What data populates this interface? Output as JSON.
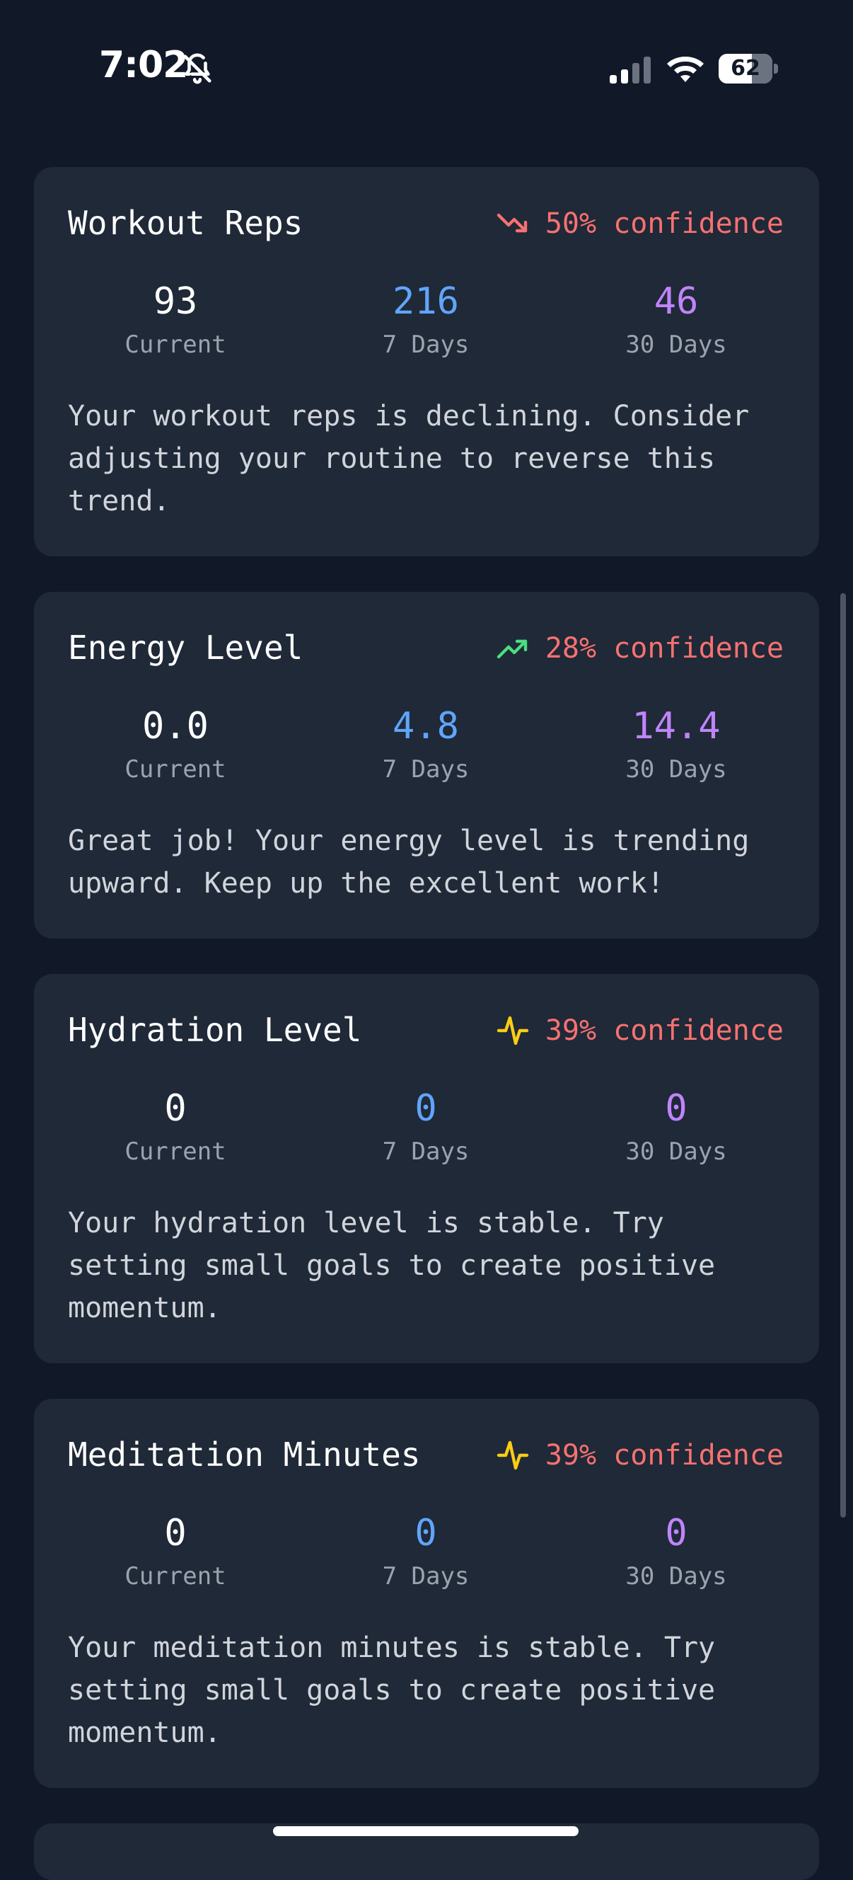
{
  "status_bar": {
    "time": "7:02",
    "battery_level": "62",
    "icons": [
      "bell-slash-icon",
      "cellular-signal-icon",
      "wifi-icon",
      "battery-icon"
    ]
  },
  "colors": {
    "background": "#111827",
    "card": "#1f2937",
    "confidence": "#f87171",
    "current": "#ffffff",
    "seven_day": "#60a5fa",
    "thirty_day": "#c084fc",
    "trend_down": "#f87171",
    "trend_up": "#4ade80",
    "stable": "#facc15"
  },
  "cards": [
    {
      "title": "Workout Reps",
      "trend_icon": "trending-down-icon",
      "confidence": "50% confidence",
      "current": {
        "value": "93",
        "label": "Current"
      },
      "seven_days": {
        "value": "216",
        "label": "7 Days"
      },
      "thirty_days": {
        "value": "46",
        "label": "30 Days"
      },
      "message": "Your workout reps is declining. Consider adjusting your routine to reverse this trend."
    },
    {
      "title": "Energy Level",
      "trend_icon": "trending-up-icon",
      "confidence": "28% confidence",
      "current": {
        "value": "0.0",
        "label": "Current"
      },
      "seven_days": {
        "value": "4.8",
        "label": "7 Days"
      },
      "thirty_days": {
        "value": "14.4",
        "label": "30 Days"
      },
      "message": "Great job! Your energy level is trending upward. Keep up the excellent work!"
    },
    {
      "title": "Hydration Level",
      "trend_icon": "activity-pulse-icon",
      "confidence": "39% confidence",
      "current": {
        "value": "0",
        "label": "Current"
      },
      "seven_days": {
        "value": "0",
        "label": "7 Days"
      },
      "thirty_days": {
        "value": "0",
        "label": "30 Days"
      },
      "message": "Your hydration level is stable. Try setting small goals to create positive momentum."
    },
    {
      "title": "Meditation Minutes",
      "trend_icon": "activity-pulse-icon",
      "confidence": "39% confidence",
      "current": {
        "value": "0",
        "label": "Current"
      },
      "seven_days": {
        "value": "0",
        "label": "7 Days"
      },
      "thirty_days": {
        "value": "0",
        "label": "30 Days"
      },
      "message": "Your meditation minutes is stable. Try setting small goals to create positive momentum."
    }
  ]
}
